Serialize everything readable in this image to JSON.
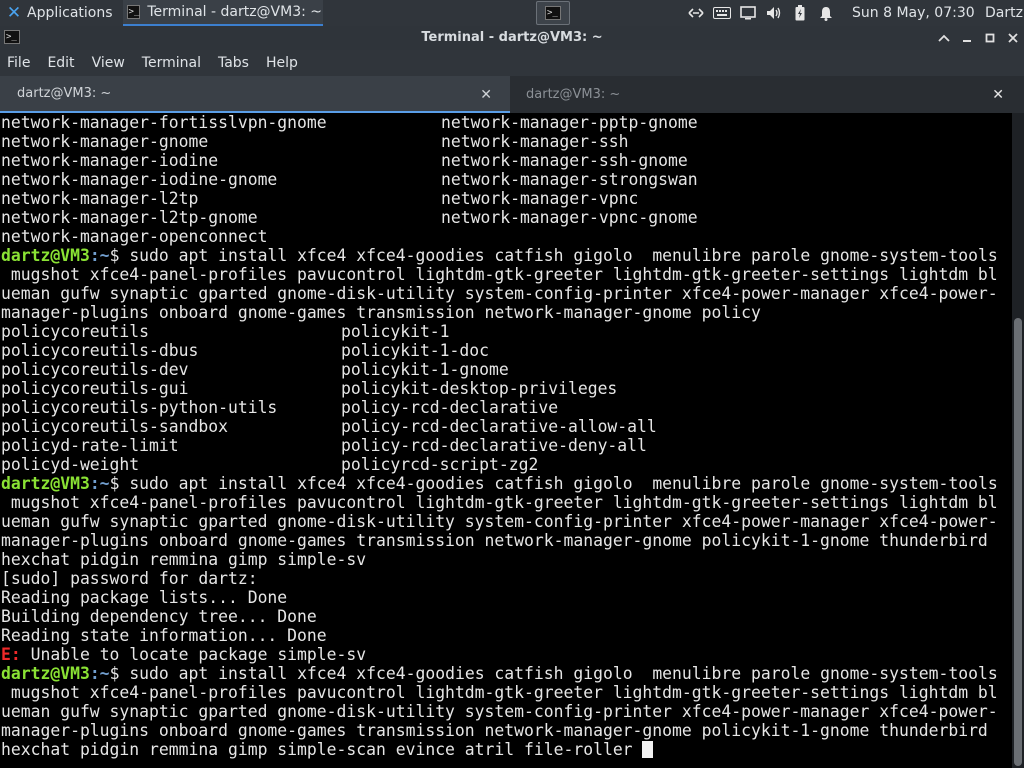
{
  "panel": {
    "applications_label": "Applications",
    "task_label": "Terminal - dartz@VM3: ~",
    "clock": "Sun  8 May, 07:30",
    "user": "Dartz",
    "tray_icons": [
      "network-icon",
      "keyboard-icon",
      "display-icon",
      "volume-icon",
      "battery-icon",
      "notification-bell-icon"
    ]
  },
  "window": {
    "title": "Terminal - dartz@VM3: ~"
  },
  "menubar": {
    "items": [
      "File",
      "Edit",
      "View",
      "Terminal",
      "Tabs",
      "Help"
    ]
  },
  "tabs": [
    {
      "label": "dartz@VM3: ~",
      "active": true
    },
    {
      "label": "dartz@VM3: ~",
      "active": false
    }
  ],
  "terminal": {
    "prompt_user": "dartz@VM3",
    "prompt_path": ":~",
    "prompt_symbol": "$ ",
    "two_col_a": [
      [
        "network-manager-fortisslvpn-gnome",
        "network-manager-pptp-gnome"
      ],
      [
        "network-manager-gnome",
        "network-manager-ssh"
      ],
      [
        "network-manager-iodine",
        "network-manager-ssh-gnome"
      ],
      [
        "network-manager-iodine-gnome",
        "network-manager-strongswan"
      ],
      [
        "network-manager-l2tp",
        "network-manager-vpnc"
      ],
      [
        "network-manager-l2tp-gnome",
        "network-manager-vpnc-gnome"
      ],
      [
        "network-manager-openconnect",
        ""
      ]
    ],
    "cmd1": [
      "sudo apt install xfce4 xfce4-goodies catfish gigolo  menulibre parole gnome-system-tools",
      " mugshot xfce4-panel-profiles pavucontrol lightdm-gtk-greeter lightdm-gtk-greeter-settings lightdm bl",
      "ueman gufw synaptic gparted gnome-disk-utility system-config-printer xfce4-power-manager xfce4-power-",
      "manager-plugins onboard gnome-games transmission network-manager-gnome policy"
    ],
    "two_col_b": [
      [
        "policycoreutils",
        "policykit-1"
      ],
      [
        "policycoreutils-dbus",
        "policykit-1-doc"
      ],
      [
        "policycoreutils-dev",
        "policykit-1-gnome"
      ],
      [
        "policycoreutils-gui",
        "policykit-desktop-privileges"
      ],
      [
        "policycoreutils-python-utils",
        "policy-rcd-declarative"
      ],
      [
        "policycoreutils-sandbox",
        "policy-rcd-declarative-allow-all"
      ],
      [
        "policyd-rate-limit",
        "policy-rcd-declarative-deny-all"
      ],
      [
        "policyd-weight",
        "policyrcd-script-zg2"
      ]
    ],
    "cmd2": [
      "sudo apt install xfce4 xfce4-goodies catfish gigolo  menulibre parole gnome-system-tools",
      " mugshot xfce4-panel-profiles pavucontrol lightdm-gtk-greeter lightdm-gtk-greeter-settings lightdm bl",
      "ueman gufw synaptic gparted gnome-disk-utility system-config-printer xfce4-power-manager xfce4-power-",
      "manager-plugins onboard gnome-games transmission network-manager-gnome policykit-1-gnome thunderbird ",
      "hexchat pidgin remmina gimp simple-sv"
    ],
    "output": [
      "[sudo] password for dartz:",
      "Reading package lists... Done",
      "Building dependency tree... Done",
      "Reading state information... Done"
    ],
    "error_prefix": "E:",
    "error_text": " Unable to locate package simple-sv",
    "cmd3": [
      "sudo apt install xfce4 xfce4-goodies catfish gigolo  menulibre parole gnome-system-tools",
      " mugshot xfce4-panel-profiles pavucontrol lightdm-gtk-greeter lightdm-gtk-greeter-settings lightdm bl",
      "ueman gufw synaptic gparted gnome-disk-utility system-config-printer xfce4-power-manager xfce4-power-",
      "manager-plugins onboard gnome-games transmission network-manager-gnome policykit-1-gnome thunderbird ",
      "hexchat pidgin remmina gimp simple-scan evince atril file-roller "
    ]
  }
}
